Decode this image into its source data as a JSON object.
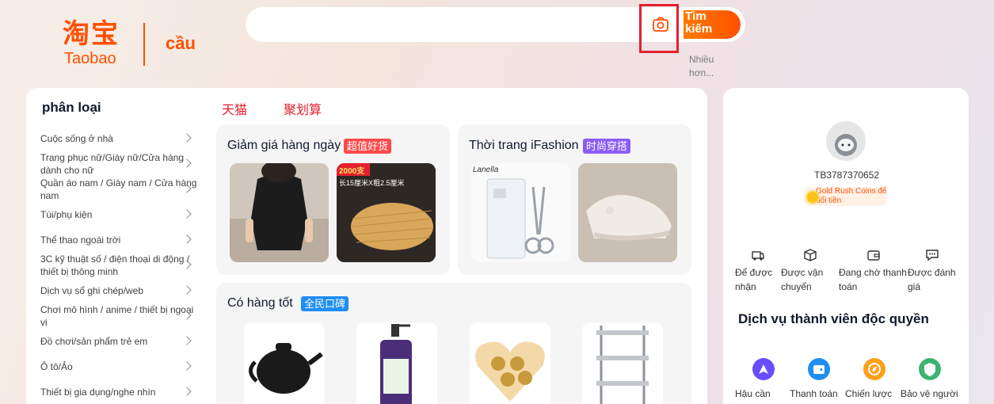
{
  "header": {
    "logo_cn": "淘宝",
    "logo_en": "Taobao",
    "logo_sub": "cầu",
    "search_placeholder": "",
    "search_button": "Tìm kiếm",
    "more_link": "Nhiều hơn..."
  },
  "categories": {
    "title": "phân loại",
    "items": [
      {
        "label": "Cuộc sống ở nhà"
      },
      {
        "label": "Trang phục nữ/Giày nữ/Cửa hàng dành cho nữ"
      },
      {
        "label": "Quần áo nam / Giày nam / Cửa hàng nam"
      },
      {
        "label": "Túi/phụ kiện"
      },
      {
        "label": "Thể thao ngoài trời"
      },
      {
        "label": "3C kỹ thuật số / điện thoại di động / thiết bị thông minh"
      },
      {
        "label": "Dịch vụ sổ ghi chép/web"
      },
      {
        "label": "Chơi mô hình / anime / thiết bị ngoại vi"
      },
      {
        "label": "Đồ chơi/sản phẩm trẻ em"
      },
      {
        "label": "Ô tô/Ảo"
      },
      {
        "label": "Thiết bị gia dụng/nghe nhìn"
      }
    ]
  },
  "tabs": [
    {
      "label": "天猫"
    },
    {
      "label": "聚划算"
    }
  ],
  "cards": {
    "daily": {
      "title": "Giảm giá hàng ngày",
      "badge": "超值好货",
      "badge_color": "#ff4a4a"
    },
    "fashion": {
      "title": "Thời trang iFashion",
      "badge": "时尚穿搭",
      "badge_color": "#8a5cf6"
    },
    "goods": {
      "title": "Có hàng tốt",
      "badge": "全民口碑",
      "badge_color": "#1f8ef1"
    }
  },
  "product_texts": {
    "noodle_tag": "2000支",
    "noodle_desc": "长15厘米X粗2.5厘米",
    "scissors_brand": "Lanella"
  },
  "user": {
    "id": "TB3787370652",
    "coins_text": "Gold Rush Coins để đổi tiền"
  },
  "orders": [
    {
      "label": "Để được nhận",
      "icon": "delivery-truck-icon"
    },
    {
      "label": "Được vận chuyển",
      "icon": "package-box-icon"
    },
    {
      "label": "Đang chờ thanh toán",
      "icon": "wallet-icon"
    },
    {
      "label": "Được đánh giá",
      "icon": "comment-icon"
    }
  ],
  "services": {
    "title": "Dịch vụ thành viên độc quyền",
    "items": [
      {
        "label": "Hậu cần",
        "icon": "rocket-icon",
        "color": "#6a4dff"
      },
      {
        "label": "Thanh toán",
        "icon": "wallet-icon",
        "color": "#1f8ef1"
      },
      {
        "label": "Chiến lược",
        "icon": "compass-icon",
        "color": "#ff9f1a"
      },
      {
        "label": "Bảo vệ người",
        "icon": "shield-icon",
        "color": "#3cb371"
      }
    ]
  },
  "colors": {
    "brand": "#ff5000",
    "accent_red": "#e4202e"
  }
}
